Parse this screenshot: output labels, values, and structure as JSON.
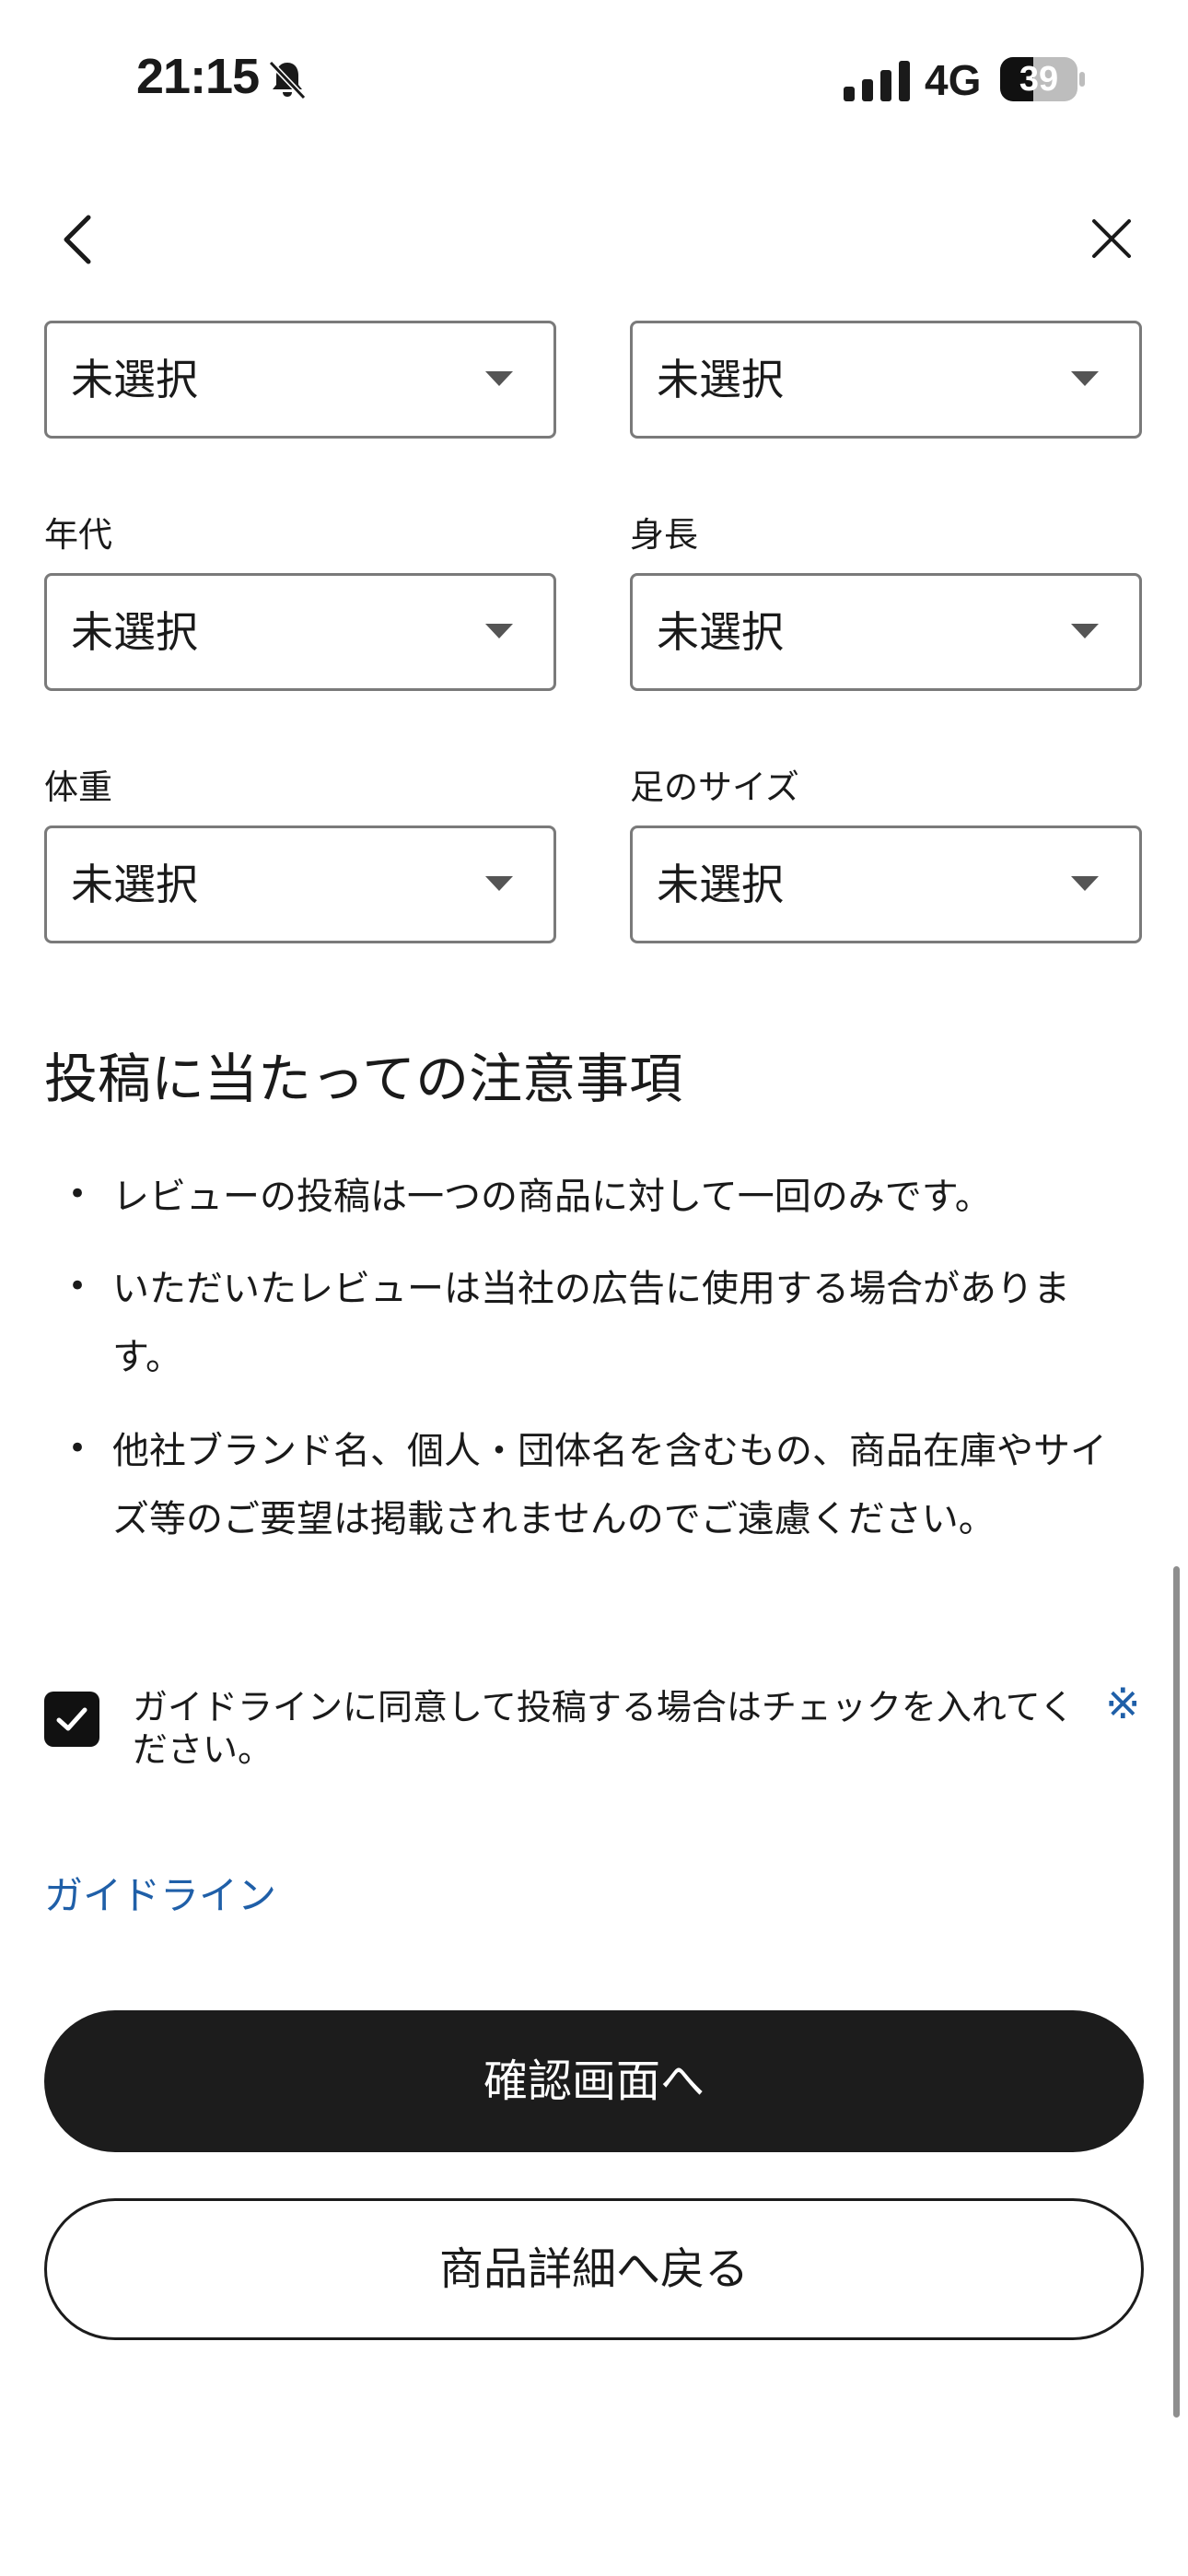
{
  "status_bar": {
    "time": "21:15",
    "network": "4G",
    "battery": "39"
  },
  "icons": {
    "bell": "bell-slash-icon",
    "signal": "cellular-signal-icon",
    "battery": "battery-icon",
    "back": "chevron-left-icon",
    "close": "close-icon",
    "caret": "caret-down-icon",
    "check": "checkmark-icon"
  },
  "form": {
    "top_row": [
      {
        "label": "",
        "value": "未選択"
      },
      {
        "label": "",
        "value": "未選択"
      }
    ],
    "middle_row": [
      {
        "label": "年代",
        "value": "未選択"
      },
      {
        "label": "身長",
        "value": "未選択"
      }
    ],
    "bottom_row": [
      {
        "label": "体重",
        "value": "未選択"
      },
      {
        "label": "足のサイズ",
        "value": "未選択"
      }
    ]
  },
  "notes": {
    "title": "投稿に当たっての注意事項",
    "bullet": "•",
    "items": [
      "レビューの投稿は一つの商品に対して一回のみです。",
      "いただいたレビューは当社の広告に使用する場合があります。",
      "他社ブランド名、個人・団体名を含むもの、商品在庫やサイズ等のご要望は掲載されませんのでご遠慮ください。"
    ]
  },
  "agreement": {
    "text": "ガイドラインに同意して投稿する場合はチェックを入れてください。",
    "required_mark": "※",
    "checked": true
  },
  "guideline_link": "ガイドライン",
  "buttons": {
    "confirm": "確認画面へ",
    "back_to_product": "商品詳細へ戻る"
  },
  "colors": {
    "link": "#1f5fa8",
    "primary_button": "#1c1c1c",
    "border": "#7a7a7a"
  }
}
